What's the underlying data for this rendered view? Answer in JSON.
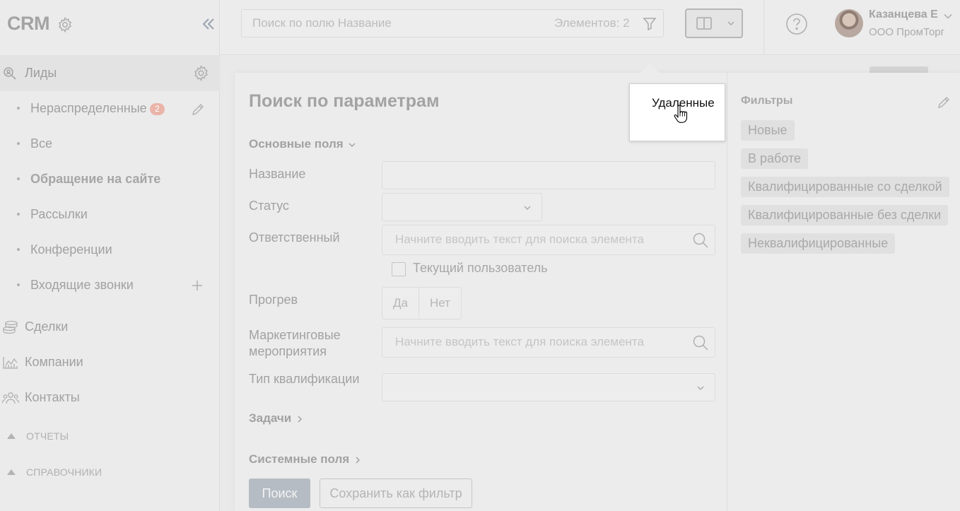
{
  "app": {
    "logo": "CRM"
  },
  "sidebar": {
    "leads_label": "Лиды",
    "lead_items": [
      {
        "label": "Нераспределенные",
        "badge": "2"
      },
      {
        "label": "Все"
      },
      {
        "label": "Обращение на сайте"
      },
      {
        "label": "Рассылки"
      },
      {
        "label": "Конференции"
      },
      {
        "label": "Входящие звонки"
      }
    ],
    "main_items": [
      {
        "label": "Сделки",
        "icon": "coins-icon"
      },
      {
        "label": "Компании",
        "icon": "chart-icon"
      },
      {
        "label": "Контакты",
        "icon": "users-icon"
      }
    ],
    "sections": [
      {
        "label": "ОТЧЕТЫ"
      },
      {
        "label": "СПРАВОЧНИКИ"
      }
    ]
  },
  "topbar": {
    "search_placeholder": "Поиск по полю Название",
    "elements_count": "Элементов: 2",
    "user_name": "Казанцева Е",
    "company": "ООО ПромТорг"
  },
  "panel": {
    "title": "Поиск по параметрам",
    "main_fields_head": "Основные поля",
    "fields": {
      "name_label": "Название",
      "status_label": "Статус",
      "responsible_label": "Ответственный",
      "responsible_placeholder": "Начните вводить текст для поиска элемента",
      "current_user_label": "Текущий пользователь",
      "warmup_label": "Прогрев",
      "yes": "Да",
      "no": "Нет",
      "marketing_label_1": "Маркетинговые",
      "marketing_label_2": "мероприятия",
      "marketing_placeholder": "Начните вводить текст для поиска элемента",
      "qualification_label": "Тип квалификации"
    },
    "tasks_head": "Задачи",
    "system_fields_head": "Системные поля",
    "search_button": "Поиск",
    "save_filter_button": "Сохранить как фильтр",
    "filters_title": "Фильтры",
    "filters": [
      "Новые",
      "В работе",
      "Квалифицированные со сделкой",
      "Квалифицированные без сделки",
      "Неквалифицированные"
    ]
  },
  "tooltip": {
    "text": "Удаленные"
  },
  "colors": {
    "badge": "#eab4a8",
    "primary_button": "#b6bcc4"
  }
}
